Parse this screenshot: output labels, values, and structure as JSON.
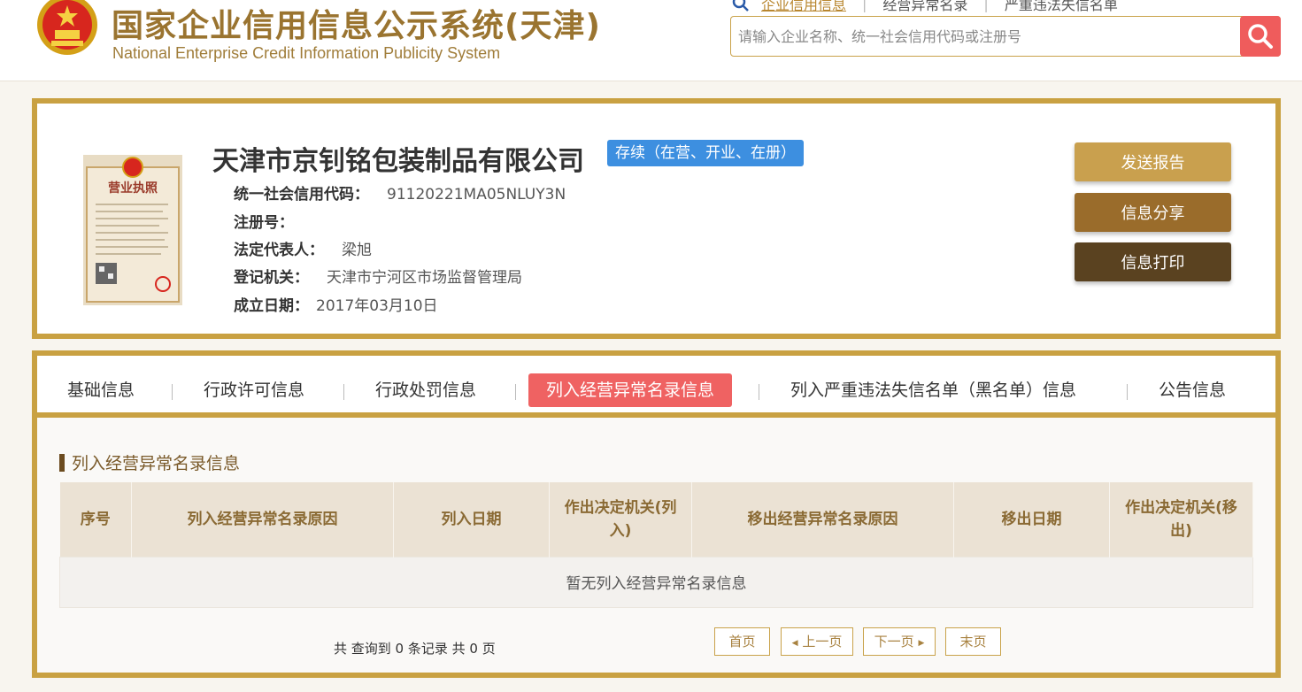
{
  "header": {
    "title": "国家企业信用信息公示系统(天津)",
    "subtitle": "National Enterprise Credit Information Publicity System",
    "top_links": [
      {
        "label": "企业信用信息"
      },
      {
        "label": "经营异常名录"
      },
      {
        "label": "严重违法失信名单"
      }
    ],
    "search": {
      "placeholder": "请输入企业名称、统一社会信用代码或注册号",
      "value": ""
    }
  },
  "company": {
    "name": "天津市京钊铭包装制品有限公司",
    "status": "存续（在营、开业、在册）",
    "fields": [
      {
        "label": "统一社会信用代码：",
        "value": "91120221MA05NLUY3N"
      },
      {
        "label": "注册号：",
        "value": ""
      },
      {
        "label": "法定代表人：",
        "value": "梁旭"
      },
      {
        "label": "登记机关：",
        "value": "天津市宁河区市场监督管理局"
      },
      {
        "label": "成立日期：",
        "value": "2017年03月10日"
      }
    ],
    "license_title": "营业执照"
  },
  "actions": {
    "send": "发送报告",
    "share": "信息分享",
    "print": "信息打印"
  },
  "tabs": [
    {
      "label": "基础信息"
    },
    {
      "label": "行政许可信息"
    },
    {
      "label": "行政处罚信息"
    },
    {
      "label": "列入经营异常名录信息"
    },
    {
      "label": "列入严重违法失信名单（黑名单）信息"
    },
    {
      "label": "公告信息"
    }
  ],
  "section": {
    "title": "列入经营异常名录信息",
    "columns": [
      "序号",
      "列入经营异常名录原因",
      "列入日期",
      "作出决定机关(列入)",
      "移出经营异常名录原因",
      "移出日期",
      "作出决定机关(移出)"
    ],
    "empty_text": "暂无列入经营异常名录信息"
  },
  "pagination": {
    "summary": "共 查询到 0 条记录 共 0 页",
    "first": "首页",
    "prev": "上一页",
    "next": "下一页",
    "last": "末页"
  },
  "colors": {
    "gold_border": "#c9a142",
    "active_tab": "#ef6262",
    "status_badge": "#3d8fe0",
    "search_button": "#ef5c5c"
  }
}
